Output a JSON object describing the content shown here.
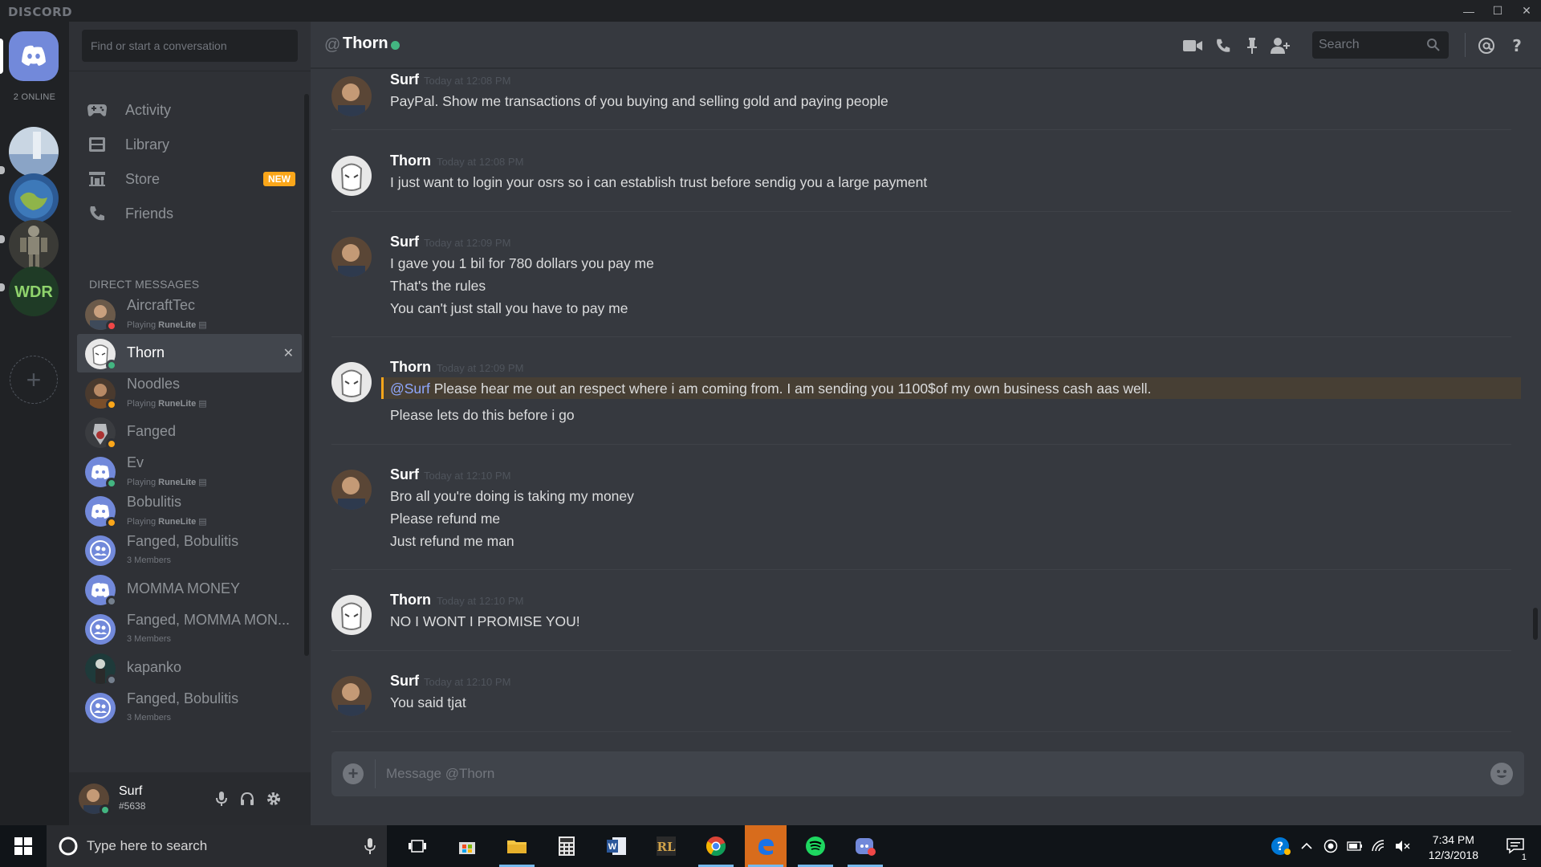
{
  "app": {
    "wordmark": "DISCORD",
    "window_controls": [
      "—",
      "☐",
      "✕"
    ]
  },
  "guilds": {
    "online_count": "2 ONLINE",
    "servers": [
      {
        "name": "server-landscape",
        "color": "#8aa4c6"
      },
      {
        "name": "server-planet",
        "color": "#4a7bb7"
      },
      {
        "name": "server-armor",
        "color": "#5a5a52"
      },
      {
        "name": "server-wdr",
        "color": "#2f7a3a"
      }
    ],
    "add_label": "+"
  },
  "sidebar": {
    "search_placeholder": "Find or start a conversation",
    "nav": [
      {
        "label": "Activity",
        "icon": "gamepad-icon"
      },
      {
        "label": "Library",
        "icon": "library-icon"
      },
      {
        "label": "Store",
        "icon": "store-icon",
        "badge": "NEW"
      },
      {
        "label": "Friends",
        "icon": "friends-icon"
      }
    ],
    "dm_header": "DIRECT MESSAGES",
    "dms": [
      {
        "name": "AircraftTec",
        "status": "dnd",
        "activity_prefix": "Playing",
        "activity_game": "RuneLite"
      },
      {
        "name": "Thorn",
        "status": "online",
        "active": true,
        "close": "✕"
      },
      {
        "name": "Noodles",
        "status": "idle",
        "activity_prefix": "Playing",
        "activity_game": "RuneLite"
      },
      {
        "name": "Fanged",
        "status": "idle"
      },
      {
        "name": "Ev",
        "status": "online",
        "activity_prefix": "Playing",
        "activity_game": "RuneLite"
      },
      {
        "name": "Bobulitis",
        "status": "idle",
        "activity_prefix": "Playing",
        "activity_game": "RuneLite"
      },
      {
        "name": "Fanged, Bobulitis",
        "group": true,
        "members": "3 Members"
      },
      {
        "name": "MOMMA MONEY",
        "status": "offline"
      },
      {
        "name": "Fanged, MOMMA MON...",
        "group": true,
        "members": "3 Members"
      },
      {
        "name": "kapanko",
        "status": "offline"
      },
      {
        "name": "Fanged, Bobulitis",
        "group": true,
        "members": "3 Members"
      }
    ],
    "user": {
      "name": "Surf",
      "tag": "#5638"
    }
  },
  "chat": {
    "at_symbol": "@",
    "channel_name": "Thorn",
    "search_placeholder": "Search",
    "composer_placeholder": "Message @Thorn",
    "messages": [
      {
        "author": "Surf",
        "timestamp": "Today at 12:08 PM",
        "lines": [
          "PayPal. Show me transactions of you buying and selling gold and paying people"
        ]
      },
      {
        "author": "Thorn",
        "timestamp": "Today at 12:08 PM",
        "lines": [
          "I just want to login your osrs so i can establish trust before sendig you a large payment"
        ]
      },
      {
        "author": "Surf",
        "timestamp": "Today at 12:09 PM",
        "lines": [
          "I gave you 1 bil for 780 dollars you pay me",
          "That's the rules",
          "You can't just stall you have to pay me"
        ]
      },
      {
        "author": "Thorn",
        "timestamp": "Today at 12:09 PM",
        "mention": "@Surf",
        "lines": [
          " Please hear me out an respect where i am coming from. I am sending you 1100$of my own business cash aas well.",
          "Please lets do this before i go"
        ]
      },
      {
        "author": "Surf",
        "timestamp": "Today at 12:10 PM",
        "lines": [
          "Bro all you're doing is taking my money",
          "Please refund me",
          "Just refund me man"
        ]
      },
      {
        "author": "Thorn",
        "timestamp": "Today at 12:10 PM",
        "lines": [
          "NO I WONT I PROMISE YOU!"
        ]
      },
      {
        "author": "Surf",
        "timestamp": "Today at 12:10 PM",
        "lines": [
          "You said tjat"
        ]
      }
    ]
  },
  "taskbar": {
    "search_placeholder": "Type here to search",
    "time": "7:34 PM",
    "date": "12/3/2018",
    "notification_count": "1"
  },
  "colors": {
    "accent": "#7289da",
    "online": "#43b581",
    "idle": "#faa61a",
    "dnd": "#f04747",
    "offline": "#747f8d",
    "mention_bar": "#faa61a"
  }
}
